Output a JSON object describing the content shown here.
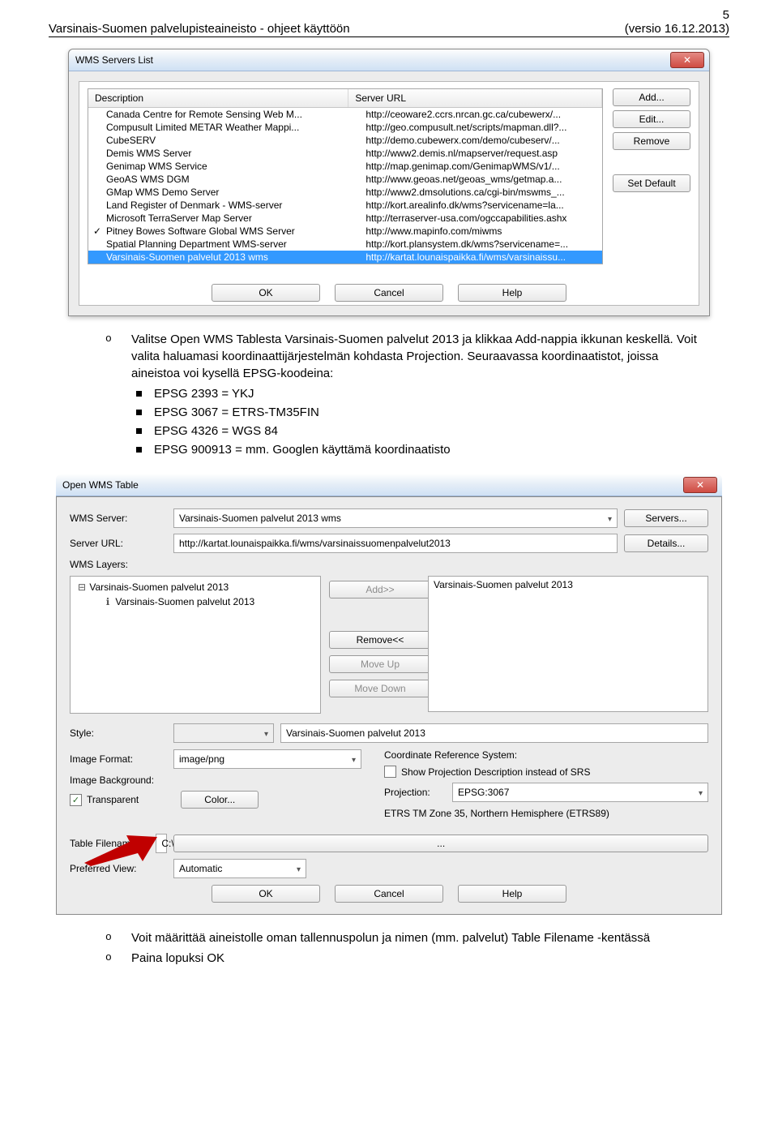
{
  "header": {
    "left": "Varsinais-Suomen palvelupisteaineisto - ohjeet käyttöön",
    "right": "(versio 16.12.2013)",
    "page_number": "5"
  },
  "dialog1": {
    "title": "WMS Servers List",
    "col_desc": "Description",
    "col_url": "Server URL",
    "rows": [
      {
        "desc": "Canada Centre for Remote Sensing Web M...",
        "url": "http://ceoware2.ccrs.nrcan.gc.ca/cubewerx/...",
        "checked": false,
        "selected": false
      },
      {
        "desc": "Compusult Limited METAR Weather Mappi...",
        "url": "http://geo.compusult.net/scripts/mapman.dll?...",
        "checked": false,
        "selected": false
      },
      {
        "desc": "CubeSERV",
        "url": "http://demo.cubewerx.com/demo/cubeserv/...",
        "checked": false,
        "selected": false
      },
      {
        "desc": "Demis WMS Server",
        "url": "http://www2.demis.nl/mapserver/request.asp",
        "checked": false,
        "selected": false
      },
      {
        "desc": "Genimap WMS Service",
        "url": "http://map.genimap.com/GenimapWMS/v1/...",
        "checked": false,
        "selected": false
      },
      {
        "desc": "GeoAS WMS DGM",
        "url": "http://www.geoas.net/geoas_wms/getmap.a...",
        "checked": false,
        "selected": false
      },
      {
        "desc": "GMap WMS Demo Server",
        "url": "http://www2.dmsolutions.ca/cgi-bin/mswms_...",
        "checked": false,
        "selected": false
      },
      {
        "desc": "Land Register of Denmark - WMS-server",
        "url": "http://kort.arealinfo.dk/wms?servicename=la...",
        "checked": false,
        "selected": false
      },
      {
        "desc": "Microsoft TerraServer Map Server",
        "url": "http://terraserver-usa.com/ogccapabilities.ashx",
        "checked": false,
        "selected": false
      },
      {
        "desc": "Pitney Bowes Software Global WMS Server",
        "url": "http://www.mapinfo.com/miwms",
        "checked": true,
        "selected": false
      },
      {
        "desc": "Spatial Planning Department WMS-server",
        "url": "http://kort.plansystem.dk/wms?servicename=...",
        "checked": false,
        "selected": false
      },
      {
        "desc": "Varsinais-Suomen palvelut 2013 wms",
        "url": "http://kartat.lounaispaikka.fi/wms/varsinaissu...",
        "checked": false,
        "selected": true
      }
    ],
    "buttons": {
      "add": "Add...",
      "edit": "Edit...",
      "remove": "Remove",
      "set_default": "Set Default",
      "ok": "OK",
      "cancel": "Cancel",
      "help": "Help"
    }
  },
  "paragraph": {
    "p1a": "Valitse Open WMS Tablesta Varsinais-Suomen palvelut 2013 ja klikkaa Add-nappia ikkunan keskellä. Voit valita haluamasi koordinaattijärjestelmän kohdasta Projection. Seuraavassa koordinaatistot, joissa aineistoa voi kysellä EPSG-koodeina:",
    "b1": "EPSG 2393 = YKJ",
    "b2": "EPSG 3067 = ETRS-TM35FIN",
    "b3": "EPSG 4326 = WGS 84",
    "b4": "EPSG 900913 = mm. Googlen käyttämä koordinaatisto"
  },
  "dialog2": {
    "title": "Open WMS Table",
    "labels": {
      "wms_server": "WMS Server:",
      "server_url": "Server URL:",
      "wms_layers": "WMS Layers:",
      "style": "Style:",
      "image_format": "Image Format:",
      "image_background": "Image Background:",
      "transparent": "Transparent",
      "color": "Color...",
      "table_filename": "Table Filename:",
      "preferred_view": "Preferred View:",
      "crs": "Coordinate Reference System:",
      "show_proj": "Show Projection Description instead of SRS",
      "projection": "Projection:",
      "crs_desc": "ETRS TM Zone 35, Northern Hemisphere (ETRS89)"
    },
    "values": {
      "wms_server": "Varsinais-Suomen palvelut 2013 wms",
      "server_url": "http://kartat.lounaispaikka.fi/wms/varsinaissuomenpalvelut2013",
      "tree_root": "Varsinais-Suomen palvelut 2013",
      "tree_child": "Varsinais-Suomen palvelut 2013",
      "right_item": "Varsinais-Suomen palvelut 2013",
      "style_value": "Varsinais-Suomen palvelut 2013",
      "image_format": "image/png",
      "projection_val": "EPSG:3067",
      "table_filename": "C:\\Users\\Nurmi\\Documents\\Untitled.TAB",
      "preferred_view": "Automatic"
    },
    "buttons": {
      "servers": "Servers...",
      "details": "Details...",
      "add": "Add>>",
      "remove": "Remove<<",
      "moveup": "Move Up",
      "movedown": "Move Down",
      "ok": "OK",
      "cancel": "Cancel",
      "help": "Help",
      "browse": "..."
    }
  },
  "footer": {
    "f1": "Voit määrittää aineistolle oman tallennuspolun ja nimen (mm. palvelut) Table Filename -kentässä",
    "f2": "Paina lopuksi OK"
  }
}
